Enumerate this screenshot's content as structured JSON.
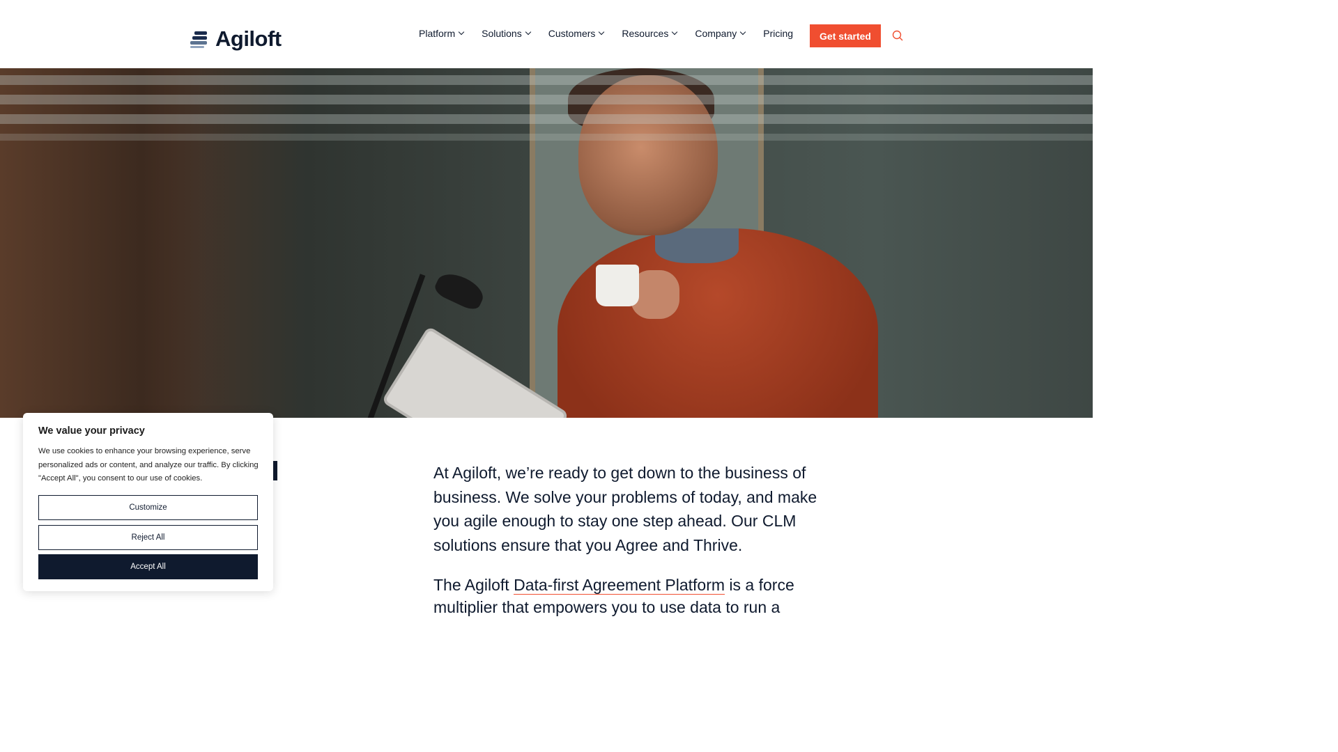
{
  "brand": {
    "name": "Agiloft"
  },
  "nav": {
    "items": [
      {
        "label": "Platform",
        "dropdown": true
      },
      {
        "label": "Solutions",
        "dropdown": true
      },
      {
        "label": "Customers",
        "dropdown": true
      },
      {
        "label": "Resources",
        "dropdown": true
      },
      {
        "label": "Company",
        "dropdown": true
      },
      {
        "label": "Pricing",
        "dropdown": false
      }
    ],
    "cta_label": "Get started",
    "search_icon": "search-icon"
  },
  "colors": {
    "accent": "#f04e30",
    "navy": "#0f1a2e"
  },
  "hero": {
    "image_icon": "hero-photo"
  },
  "content": {
    "lead": "At Agiloft, we’re ready to get down to the business of business. We solve your problems of today, and make you agile enough to stay one step ahead. Our CLM solutions ensure that you Agree and Thrive.",
    "para_before_link": "The Agiloft ",
    "para_link": "Data-first Agreement Platform",
    "para_after_link": " is a force multiplier that empowers  you to use data to run a"
  },
  "cookie": {
    "title": "We value your privacy",
    "body": "We use cookies to enhance your browsing experience, serve personalized ads or content, and analyze our traffic. By clicking \"Accept All\", you consent to our use of cookies.",
    "customize_label": "Customize",
    "reject_label": "Reject All",
    "accept_label": "Accept All"
  }
}
